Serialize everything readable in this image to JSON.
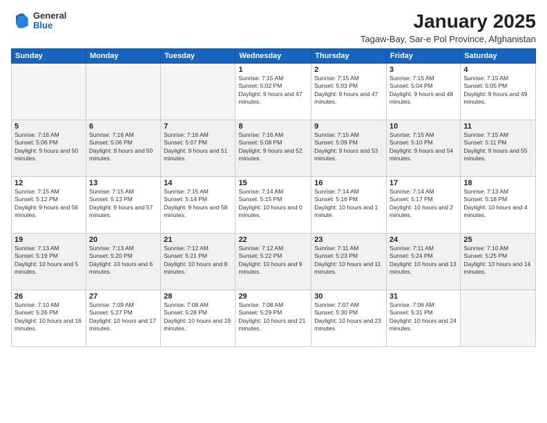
{
  "header": {
    "logo_general": "General",
    "logo_blue": "Blue",
    "title": "January 2025",
    "subtitle": "Tagaw-Bay, Sar-e Pol Province, Afghanistan"
  },
  "days_of_week": [
    "Sunday",
    "Monday",
    "Tuesday",
    "Wednesday",
    "Thursday",
    "Friday",
    "Saturday"
  ],
  "weeks": [
    [
      {
        "day": "",
        "info": ""
      },
      {
        "day": "",
        "info": ""
      },
      {
        "day": "",
        "info": ""
      },
      {
        "day": "1",
        "info": "Sunrise: 7:15 AM\nSunset: 5:02 PM\nDaylight: 9 hours and 47 minutes."
      },
      {
        "day": "2",
        "info": "Sunrise: 7:15 AM\nSunset: 5:03 PM\nDaylight: 9 hours and 47 minutes."
      },
      {
        "day": "3",
        "info": "Sunrise: 7:15 AM\nSunset: 5:04 PM\nDaylight: 9 hours and 48 minutes."
      },
      {
        "day": "4",
        "info": "Sunrise: 7:15 AM\nSunset: 5:05 PM\nDaylight: 9 hours and 49 minutes."
      }
    ],
    [
      {
        "day": "5",
        "info": "Sunrise: 7:16 AM\nSunset: 5:06 PM\nDaylight: 9 hours and 50 minutes."
      },
      {
        "day": "6",
        "info": "Sunrise: 7:16 AM\nSunset: 5:06 PM\nDaylight: 9 hours and 50 minutes."
      },
      {
        "day": "7",
        "info": "Sunrise: 7:16 AM\nSunset: 5:07 PM\nDaylight: 9 hours and 51 minutes."
      },
      {
        "day": "8",
        "info": "Sunrise: 7:16 AM\nSunset: 5:08 PM\nDaylight: 9 hours and 52 minutes."
      },
      {
        "day": "9",
        "info": "Sunrise: 7:15 AM\nSunset: 5:09 PM\nDaylight: 9 hours and 53 minutes."
      },
      {
        "day": "10",
        "info": "Sunrise: 7:15 AM\nSunset: 5:10 PM\nDaylight: 9 hours and 54 minutes."
      },
      {
        "day": "11",
        "info": "Sunrise: 7:15 AM\nSunset: 5:11 PM\nDaylight: 9 hours and 55 minutes."
      }
    ],
    [
      {
        "day": "12",
        "info": "Sunrise: 7:15 AM\nSunset: 5:12 PM\nDaylight: 9 hours and 56 minutes."
      },
      {
        "day": "13",
        "info": "Sunrise: 7:15 AM\nSunset: 5:13 PM\nDaylight: 9 hours and 57 minutes."
      },
      {
        "day": "14",
        "info": "Sunrise: 7:15 AM\nSunset: 5:14 PM\nDaylight: 9 hours and 58 minutes."
      },
      {
        "day": "15",
        "info": "Sunrise: 7:14 AM\nSunset: 5:15 PM\nDaylight: 10 hours and 0 minutes."
      },
      {
        "day": "16",
        "info": "Sunrise: 7:14 AM\nSunset: 5:16 PM\nDaylight: 10 hours and 1 minute."
      },
      {
        "day": "17",
        "info": "Sunrise: 7:14 AM\nSunset: 5:17 PM\nDaylight: 10 hours and 2 minutes."
      },
      {
        "day": "18",
        "info": "Sunrise: 7:13 AM\nSunset: 5:18 PM\nDaylight: 10 hours and 4 minutes."
      }
    ],
    [
      {
        "day": "19",
        "info": "Sunrise: 7:13 AM\nSunset: 5:19 PM\nDaylight: 10 hours and 5 minutes."
      },
      {
        "day": "20",
        "info": "Sunrise: 7:13 AM\nSunset: 5:20 PM\nDaylight: 10 hours and 6 minutes."
      },
      {
        "day": "21",
        "info": "Sunrise: 7:12 AM\nSunset: 5:21 PM\nDaylight: 10 hours and 8 minutes."
      },
      {
        "day": "22",
        "info": "Sunrise: 7:12 AM\nSunset: 5:22 PM\nDaylight: 10 hours and 9 minutes."
      },
      {
        "day": "23",
        "info": "Sunrise: 7:11 AM\nSunset: 5:23 PM\nDaylight: 10 hours and 11 minutes."
      },
      {
        "day": "24",
        "info": "Sunrise: 7:11 AM\nSunset: 5:24 PM\nDaylight: 10 hours and 13 minutes."
      },
      {
        "day": "25",
        "info": "Sunrise: 7:10 AM\nSunset: 5:25 PM\nDaylight: 10 hours and 14 minutes."
      }
    ],
    [
      {
        "day": "26",
        "info": "Sunrise: 7:10 AM\nSunset: 5:26 PM\nDaylight: 10 hours and 16 minutes."
      },
      {
        "day": "27",
        "info": "Sunrise: 7:09 AM\nSunset: 5:27 PM\nDaylight: 10 hours and 17 minutes."
      },
      {
        "day": "28",
        "info": "Sunrise: 7:08 AM\nSunset: 5:28 PM\nDaylight: 10 hours and 19 minutes."
      },
      {
        "day": "29",
        "info": "Sunrise: 7:08 AM\nSunset: 5:29 PM\nDaylight: 10 hours and 21 minutes."
      },
      {
        "day": "30",
        "info": "Sunrise: 7:07 AM\nSunset: 5:30 PM\nDaylight: 10 hours and 23 minutes."
      },
      {
        "day": "31",
        "info": "Sunrise: 7:06 AM\nSunset: 5:31 PM\nDaylight: 10 hours and 24 minutes."
      },
      {
        "day": "",
        "info": ""
      }
    ]
  ]
}
